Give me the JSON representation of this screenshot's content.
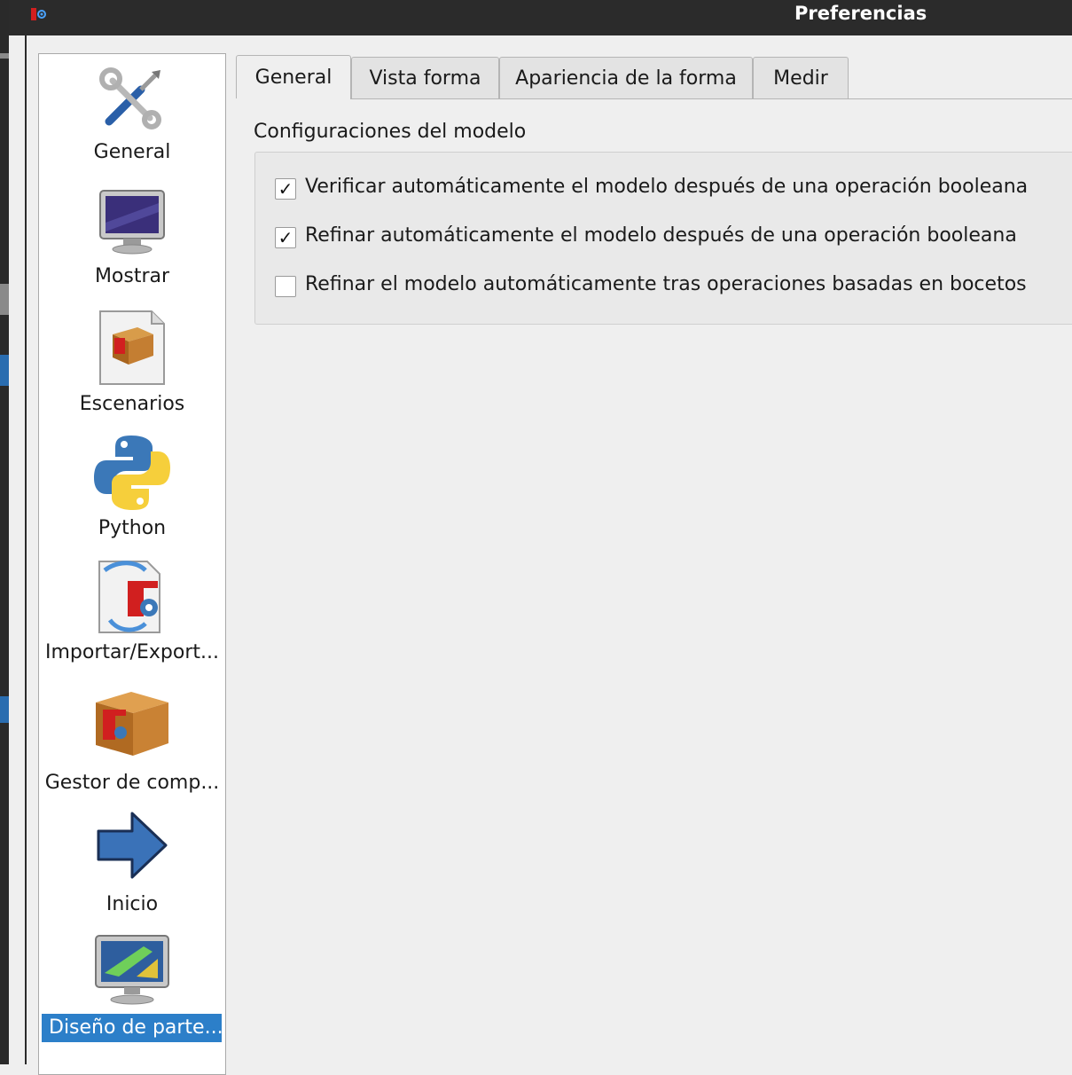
{
  "window": {
    "title": "Preferencias",
    "app_icon": "freecad-gear-icon"
  },
  "sidebar": {
    "items": [
      {
        "label": "General",
        "icon": "tools-icon"
      },
      {
        "label": "Mostrar",
        "icon": "monitor-icon"
      },
      {
        "label": "Escenarios",
        "icon": "package-document-icon"
      },
      {
        "label": "Python",
        "icon": "python-icon"
      },
      {
        "label": "Importar/Export...",
        "icon": "import-export-icon"
      },
      {
        "label": "Gestor de comp...",
        "icon": "package-icon"
      },
      {
        "label": "Inicio",
        "icon": "arrow-right-icon"
      },
      {
        "label": "Diseño de parte...",
        "icon": "part-design-icon",
        "selected": true
      }
    ]
  },
  "tabs": [
    {
      "label": "General",
      "active": true
    },
    {
      "label": "Vista forma"
    },
    {
      "label": "Apariencia de la forma"
    },
    {
      "label": "Medir"
    }
  ],
  "section": {
    "title": "Configuraciones del modelo",
    "options": [
      {
        "label": "Verificar automáticamente el modelo después de una operación booleana",
        "checked": true
      },
      {
        "label": "Refinar automáticamente el modelo después de una operación booleana",
        "checked": true
      },
      {
        "label": "Refinar el modelo automáticamente tras operaciones basadas en bocetos",
        "checked": false
      }
    ]
  },
  "colors": {
    "selection": "#2c7fc9",
    "titlebar": "#2b2b2b"
  },
  "checkmark_glyph": "✓"
}
